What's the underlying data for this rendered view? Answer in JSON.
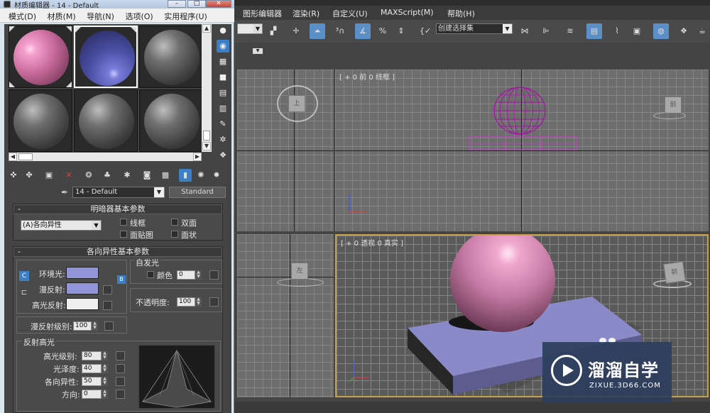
{
  "material_editor": {
    "title": "材质编辑器 - 14 - Default",
    "window_buttons": [
      "–",
      "□",
      "✕"
    ],
    "menu": [
      "模式(D)",
      "材质(M)",
      "导航(N)",
      "选项(O)",
      "实用程序(U)"
    ],
    "material_name": "14 - Default",
    "material_type": "Standard",
    "slots": [
      {
        "type": "pink",
        "selected": false
      },
      {
        "type": "blue",
        "selected": true
      },
      {
        "type": "gray",
        "selected": false
      },
      {
        "type": "gray",
        "selected": false
      },
      {
        "type": "gray",
        "selected": false
      },
      {
        "type": "gray",
        "selected": false
      }
    ],
    "shader_basic": {
      "title": "明暗器基本参数",
      "shader": "(A)各向异性",
      "wire": "线框",
      "two_sided": "双面",
      "face_map": "面贴图",
      "faceted": "面状"
    },
    "aniso_basic": {
      "title": "各向异性基本参数",
      "ambient": "环境光:",
      "diffuse": "漫反射:",
      "specular": "高光反射:",
      "self_illum": "自发光",
      "color": "颜色",
      "color_value": "0",
      "opacity": "不透明度:",
      "opacity_value": "100",
      "diffuse_level": "漫反射级别:",
      "diffuse_level_value": "100",
      "spec_highlights": "反射高光",
      "spec_level": "高光级别:",
      "spec_level_value": "80",
      "glossiness": "光泽度:",
      "glossiness_value": "40",
      "anisotropy": "各向异性:",
      "anisotropy_value": "50",
      "orientation": "方向:",
      "orientation_value": "0",
      "ambient_color": "#8f95d6",
      "diffuse_color": "#8f95d6",
      "specular_color": "#eeeeee"
    }
  },
  "main": {
    "menu": [
      "图形编辑器",
      "渲染(R)",
      "自定义(U)",
      "MAXScript(M)",
      "帮助(H)"
    ],
    "selection_set": "创建选择集",
    "viewports": {
      "front_label": "[ + 0 前 0 线框 ]",
      "persp_label": "[ + 0 透视 0 真实 ]",
      "cube_top": "上",
      "cube_front": "前",
      "cube_left": "左",
      "cube_persp": "前"
    }
  },
  "watermark": {
    "title": "溜溜自学",
    "sub": "ZIXUE.3D66.COM"
  }
}
